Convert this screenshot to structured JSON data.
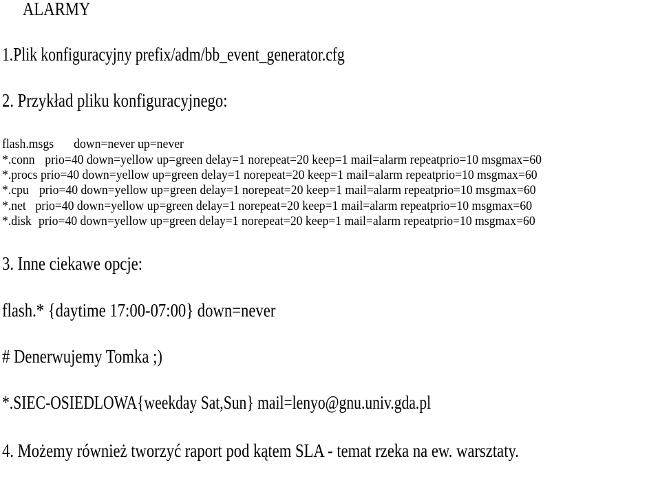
{
  "document": {
    "title": "ALARMY",
    "item1": "1.Plik konfiguracyjny prefix/adm/bb_event_generator.cfg",
    "item2": "2. Przykład pliku konfiguracyjnego:",
    "config_lines": [
      {
        "key": "flash.msgs",
        "value": "down=never up=never"
      },
      {
        "key": "*.conn",
        "value": "prio=40 down=yellow up=green delay=1 norepeat=20 keep=1 mail=alarm repeatprio=10 msgmax=60"
      },
      {
        "key": "*.procs",
        "value": "prio=40 down=yellow up=green delay=1 norepeat=20 keep=1 mail=alarm repeatprio=10 msgmax=60"
      },
      {
        "key": "*.cpu",
        "value": "prio=40 down=yellow up=green delay=1 norepeat=20 keep=1 mail=alarm repeatprio=10 msgmax=60"
      },
      {
        "key": "*.net",
        "value": "prio=40 down=yellow up=green delay=1 norepeat=20 keep=1 mail=alarm repeatprio=10 msgmax=60"
      },
      {
        "key": "*.disk",
        "value": "prio=40 down=yellow up=green delay=1 norepeat=20 keep=1 mail=alarm repeatprio=10 msgmax=60"
      }
    ],
    "item3": "3. Inne ciekawe opcje:",
    "options": [
      "flash.* {daytime 17:00-07:00} down=never",
      "# Denerwujemy Tomka ;)",
      "*.SIEC-OSIEDLOWA{weekday Sat,Sun} mail=lenyo@gnu.univ.gda.pl"
    ],
    "item4": "4. Możemy również tworzyć raport pod kątem SLA - temat rzeka na ew. warsztaty."
  }
}
